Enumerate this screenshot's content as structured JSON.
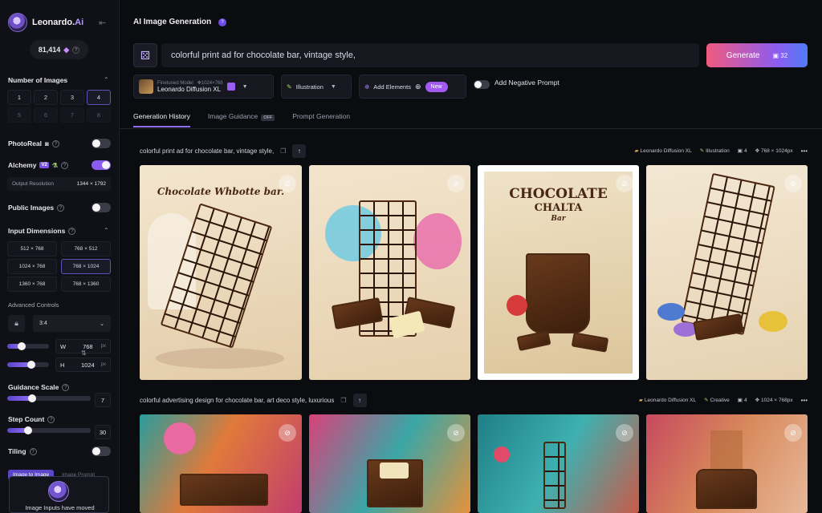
{
  "brand": {
    "name": "Leonardo.",
    "name_ai": "Ai"
  },
  "credits": {
    "amount": "81,414"
  },
  "sidebar": {
    "num_images_label": "Number of Images",
    "num_images": [
      "1",
      "2",
      "3",
      "4",
      "5",
      "6",
      "7",
      "8"
    ],
    "num_images_selected": "4",
    "photoreal_label": "PhotoReal",
    "alchemy_label": "Alchemy",
    "alchemy_badge": "V2",
    "output_resolution_label": "Output Resolution",
    "output_resolution_value": "1344 × 1792",
    "public_images_label": "Public Images",
    "input_dimensions_label": "Input Dimensions",
    "dimensions": [
      "512 × 768",
      "768 × 512",
      "1024 × 768",
      "768 × 1024",
      "1360 × 768",
      "768 × 1360"
    ],
    "dimensions_selected": "768 × 1024",
    "advanced_label": "Advanced Controls",
    "ratio": "3:4",
    "width_key": "W",
    "width_value": "768",
    "height_key": "H",
    "height_value": "1024",
    "px_unit": "px",
    "guidance_label": "Guidance Scale",
    "guidance_value": "7",
    "guidance_level": 0.3,
    "step_label": "Step Count",
    "step_value": "30",
    "step_level": 0.25,
    "tiling_label": "Tiling",
    "image_to_image": "Image to Image",
    "image_prompt": "Image Prompt",
    "moved_text": "Image Inputs have moved"
  },
  "main": {
    "title": "AI Image Generation",
    "prompt": "colorful  print ad for chocolate bar, vintage style,",
    "generate_label": "Generate",
    "generate_cost": "32",
    "model_small": "Finetuned Model",
    "model_size": "1024×768",
    "model_name": "Leonardo Diffusion XL",
    "style": "Illustration",
    "add_elements": "Add Elements",
    "new_badge": "New",
    "negative_prompt": "Add Negative Prompt",
    "tabs": [
      "Generation History",
      "Image Guidance",
      "Prompt Generation"
    ],
    "off_badge": "OFF"
  },
  "generations": [
    {
      "prompt": "colorful print ad for chocolate bar, vintage style,",
      "model": "Leonardo Diffusion XL",
      "style": "Illustration",
      "count": "4",
      "size": "768 × 1024px"
    },
    {
      "prompt": "colorful advertising design for chocolate bar, art deco style, luxurious",
      "model": "Leonardo Diffusion XL",
      "style": "Creative",
      "count": "4",
      "size": "1024 × 768px"
    }
  ],
  "image_text": {
    "img1_title": "Chocolate    Whbotte bar.",
    "img3_title": "CHOCOLATE",
    "img3_sub": "CHALTA",
    "img3_bar": "Bar"
  },
  "colors": {
    "accent": "#8f6cf3",
    "generate_start": "#f05a7e",
    "generate_end": "#4f7cf5"
  }
}
